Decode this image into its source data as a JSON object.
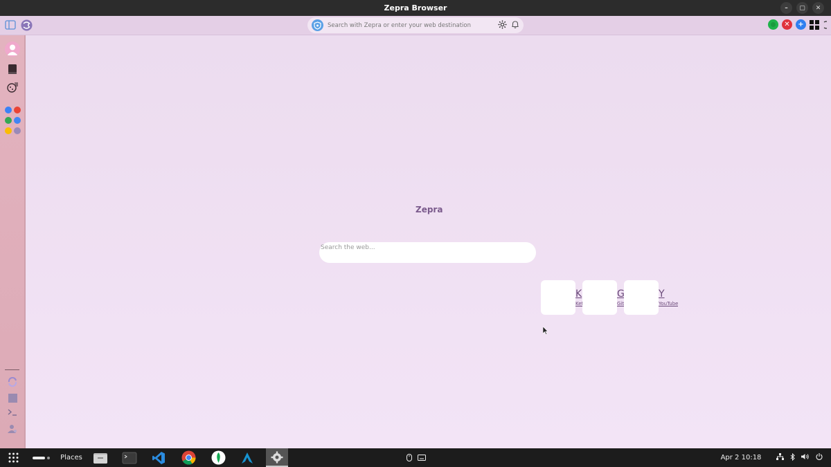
{
  "window": {
    "title": "Zepra Browser",
    "controls": [
      "–",
      "▢",
      "✕"
    ]
  },
  "toolbar": {
    "url_placeholder": "Search with Zepra or enter your web destination"
  },
  "content": {
    "brand": "Zepra",
    "search_placeholder": "Search the web...",
    "shortcuts": [
      {
        "letter": "K",
        "label": "Ket"
      },
      {
        "letter": "G",
        "label": "Git"
      },
      {
        "letter": "Y",
        "label": "YouTube"
      }
    ]
  },
  "taskbar": {
    "places": "Places",
    "datetime": "Apr 2  10:18"
  },
  "colors": {
    "green": "#1fb24a",
    "red": "#e0313c",
    "blue": "#2f7ff0"
  }
}
